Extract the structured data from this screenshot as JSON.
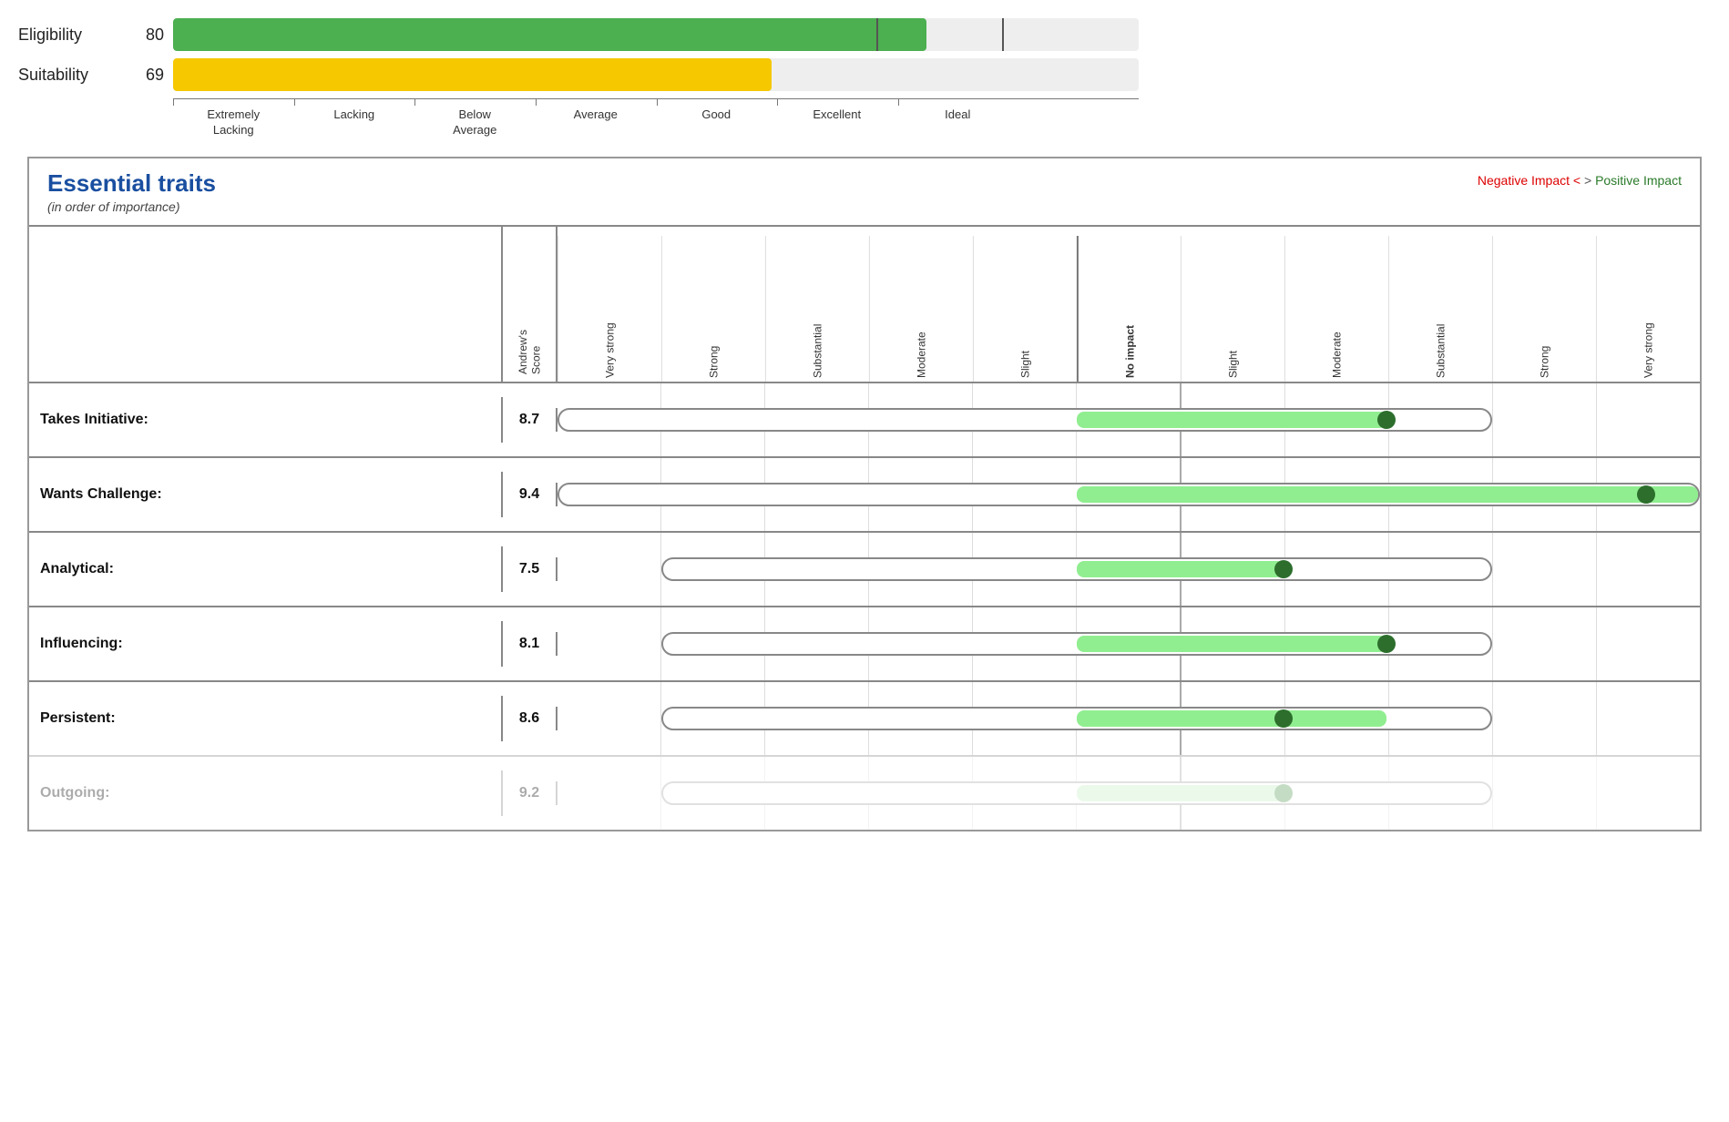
{
  "top_chart": {
    "bars": [
      {
        "label": "Eligibility",
        "score": 80,
        "color": "green",
        "fill_pct": 78
      },
      {
        "label": "Suitability",
        "score": 69,
        "color": "yellow",
        "fill_pct": 62
      }
    ],
    "axis_labels": [
      "Extremely\nLacking",
      "Lacking",
      "Below\nAverage",
      "Average",
      "Good",
      "Excellent",
      "Ideal"
    ]
  },
  "section": {
    "title": "Essential traits",
    "subtitle": "(in order of importance)",
    "impact_label_negative": "Negative Impact <",
    "impact_label_middle": " > ",
    "impact_label_positive": "Positive Impact"
  },
  "col_headers": {
    "score_label": "Andrew's\nScore",
    "chart_cols": [
      "Very strong",
      "Strong",
      "Substantial",
      "Moderate",
      "Slight",
      "No impact",
      "Slight",
      "Moderate",
      "Substantial",
      "Strong",
      "Very strong"
    ]
  },
  "traits": [
    {
      "name": "Takes Initiative:",
      "score": "8.7",
      "bar_start_col": 0,
      "bar_end_col": 9,
      "green_fill_start": 5,
      "green_fill_end": 8,
      "dot_col": 8,
      "faded": false
    },
    {
      "name": "Wants Challenge:",
      "score": "9.4",
      "bar_start_col": 0,
      "bar_end_col": 10,
      "green_fill_start": 5,
      "green_fill_end": 10,
      "dot_col": 10,
      "faded": false
    },
    {
      "name": "Analytical:",
      "score": "7.5",
      "bar_start_col": 1,
      "bar_end_col": 9,
      "green_fill_start": 5,
      "green_fill_end": 7,
      "dot_col": 7,
      "faded": false
    },
    {
      "name": "Influencing:",
      "score": "8.1",
      "bar_start_col": 1,
      "bar_end_col": 9,
      "green_fill_start": 5,
      "green_fill_end": 8,
      "dot_col": 8,
      "faded": false
    },
    {
      "name": "Persistent:",
      "score": "8.6",
      "bar_start_col": 1,
      "bar_end_col": 9,
      "green_fill_start": 5,
      "green_fill_end": 8,
      "dot_col": 8,
      "faded": false
    },
    {
      "name": "Outgoing:",
      "score": "9.2",
      "bar_start_col": 1,
      "bar_end_col": 9,
      "green_fill_start": 5,
      "green_fill_end": 7,
      "dot_col": 7,
      "faded": true
    }
  ]
}
